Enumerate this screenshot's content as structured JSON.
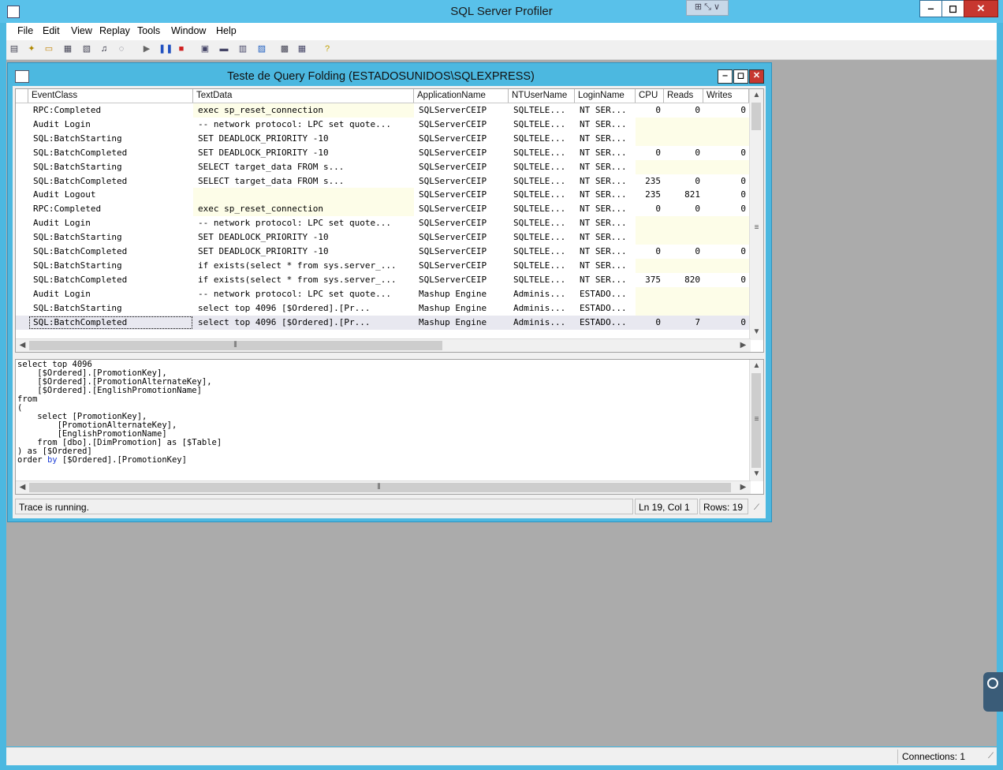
{
  "app": {
    "title": "SQL Server Profiler",
    "menu": [
      "File",
      "Edit",
      "View",
      "Replay",
      "Tools",
      "Window",
      "Help"
    ],
    "toolbar_icons": [
      "new-trace-icon",
      "new-template-icon",
      "open-icon",
      "save-icon",
      "properties-icon",
      "find-icon",
      "clear-icon",
      "start-icon",
      "pause-icon",
      "stop-icon",
      "auto-scroll-icon",
      "server-icon",
      "template-icon",
      "scroll-icon",
      "chart-icon",
      "perfmon-icon",
      "help-icon"
    ]
  },
  "trace": {
    "title": "Teste de Query Folding (ESTADOSUNIDOS\\SQLEXPRESS)",
    "columns": [
      "EventClass",
      "TextData",
      "ApplicationName",
      "NTUserName",
      "LoginName",
      "CPU",
      "Reads",
      "Writes"
    ],
    "rows": [
      {
        "event": "RPC:Completed",
        "text": "exec sp_reset_connection",
        "app": "SQLServerCEIP",
        "ntuser": "SQLTELE...",
        "login": "NT SER...",
        "cpu": "0",
        "reads": "0",
        "writes": "0"
      },
      {
        "event": "Audit Login",
        "text": "-- network protocol: LPC  set quote...",
        "app": "SQLServerCEIP",
        "ntuser": "SQLTELE...",
        "login": "NT SER...",
        "cpu": "",
        "reads": "",
        "writes": ""
      },
      {
        "event": "SQL:BatchStarting",
        "text": "SET DEADLOCK_PRIORITY -10",
        "app": "SQLServerCEIP",
        "ntuser": "SQLTELE...",
        "login": "NT SER...",
        "cpu": "",
        "reads": "",
        "writes": ""
      },
      {
        "event": "SQL:BatchCompleted",
        "text": "SET DEADLOCK_PRIORITY -10",
        "app": "SQLServerCEIP",
        "ntuser": "SQLTELE...",
        "login": "NT SER...",
        "cpu": "0",
        "reads": "0",
        "writes": "0"
      },
      {
        "event": "SQL:BatchStarting",
        "text": "SELECT target_data          FROM s...",
        "app": "SQLServerCEIP",
        "ntuser": "SQLTELE...",
        "login": "NT SER...",
        "cpu": "",
        "reads": "",
        "writes": ""
      },
      {
        "event": "SQL:BatchCompleted",
        "text": "SELECT target_data          FROM s...",
        "app": "SQLServerCEIP",
        "ntuser": "SQLTELE...",
        "login": "NT SER...",
        "cpu": "235",
        "reads": "0",
        "writes": "0"
      },
      {
        "event": "Audit Logout",
        "text": "",
        "app": "SQLServerCEIP",
        "ntuser": "SQLTELE...",
        "login": "NT SER...",
        "cpu": "235",
        "reads": "821",
        "writes": "0"
      },
      {
        "event": "RPC:Completed",
        "text": "exec sp_reset_connection",
        "app": "SQLServerCEIP",
        "ntuser": "SQLTELE...",
        "login": "NT SER...",
        "cpu": "0",
        "reads": "0",
        "writes": "0"
      },
      {
        "event": "Audit Login",
        "text": "-- network protocol: LPC  set quote...",
        "app": "SQLServerCEIP",
        "ntuser": "SQLTELE...",
        "login": "NT SER...",
        "cpu": "",
        "reads": "",
        "writes": ""
      },
      {
        "event": "SQL:BatchStarting",
        "text": "SET DEADLOCK_PRIORITY -10",
        "app": "SQLServerCEIP",
        "ntuser": "SQLTELE...",
        "login": "NT SER...",
        "cpu": "",
        "reads": "",
        "writes": ""
      },
      {
        "event": "SQL:BatchCompleted",
        "text": "SET DEADLOCK_PRIORITY -10",
        "app": "SQLServerCEIP",
        "ntuser": "SQLTELE...",
        "login": "NT SER...",
        "cpu": "0",
        "reads": "0",
        "writes": "0"
      },
      {
        "event": "SQL:BatchStarting",
        "text": "if exists(select * from sys.server_...",
        "app": "SQLServerCEIP",
        "ntuser": "SQLTELE...",
        "login": "NT SER...",
        "cpu": "",
        "reads": "",
        "writes": ""
      },
      {
        "event": "SQL:BatchCompleted",
        "text": "if exists(select * from sys.server_...",
        "app": "SQLServerCEIP",
        "ntuser": "SQLTELE...",
        "login": "NT SER...",
        "cpu": "375",
        "reads": "820",
        "writes": "0"
      },
      {
        "event": "Audit Login",
        "text": "-- network protocol: LPC  set quote...",
        "app": "Mashup Engine",
        "ntuser": "Adminis...",
        "login": "ESTADO...",
        "cpu": "",
        "reads": "",
        "writes": ""
      },
      {
        "event": "SQL:BatchStarting",
        "text": "select top 4096      [$Ordered].[Pr...",
        "app": "Mashup Engine",
        "ntuser": "Adminis...",
        "login": "ESTADO...",
        "cpu": "",
        "reads": "",
        "writes": ""
      },
      {
        "event": "SQL:BatchCompleted",
        "text": "select top 4096      [$Ordered].[Pr...",
        "app": "Mashup Engine",
        "ntuser": "Adminis...",
        "login": "ESTADO...",
        "cpu": "0",
        "reads": "7",
        "writes": "0"
      }
    ],
    "selected_row": 15
  },
  "detail": {
    "lines": [
      "select top 4096",
      "    [$Ordered].[PromotionKey],",
      "    [$Ordered].[PromotionAlternateKey],",
      "    [$Ordered].[EnglishPromotionName]",
      "from",
      "(",
      "    select [PromotionKey],",
      "        [PromotionAlternateKey],",
      "        [EnglishPromotionName]",
      "    from [dbo].[DimPromotion] as [$Table]",
      ") as [$Ordered]",
      "order by [$Ordered].[PromotionKey]"
    ]
  },
  "status": {
    "message": "Trace is running.",
    "position": "Ln 19, Col 1",
    "rows": "Rows: 19",
    "connections": "Connections: 1"
  }
}
